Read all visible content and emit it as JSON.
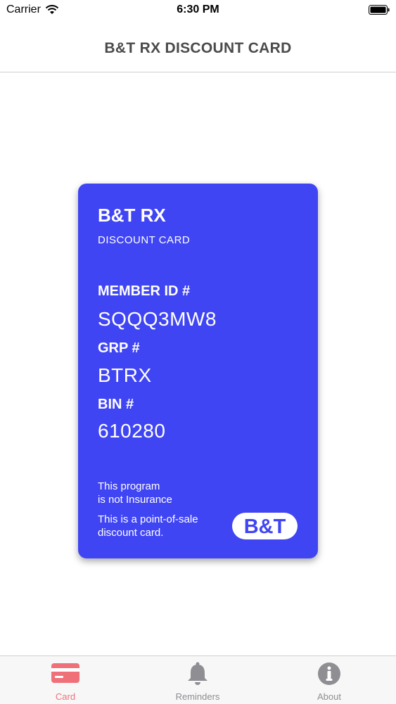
{
  "status_bar": {
    "carrier": "Carrier",
    "time": "6:30 PM"
  },
  "nav": {
    "title": "B&T RX DISCOUNT CARD"
  },
  "card": {
    "brand": "B&T RX",
    "subtitle": "DISCOUNT CARD",
    "member_id_label": "MEMBER ID #",
    "member_id": "SQQQ3MW8",
    "grp_label": "GRP #",
    "grp": "BTRX",
    "bin_label": "BIN #",
    "bin": "610280",
    "note_line1": "This program",
    "note_line2": "is not Insurance",
    "note_line3": "This is a point-of-sale",
    "note_line4": "discount card.",
    "logo_text": "B&T",
    "background_color": "#4045f4"
  },
  "tabs": [
    {
      "label": "Card",
      "icon": "credit-card-icon",
      "active": true
    },
    {
      "label": "Reminders",
      "icon": "bell-icon",
      "active": false
    },
    {
      "label": "About",
      "icon": "info-icon",
      "active": false
    }
  ],
  "colors": {
    "active_tab": "#f0707a",
    "inactive_tab": "#8e8e93"
  }
}
